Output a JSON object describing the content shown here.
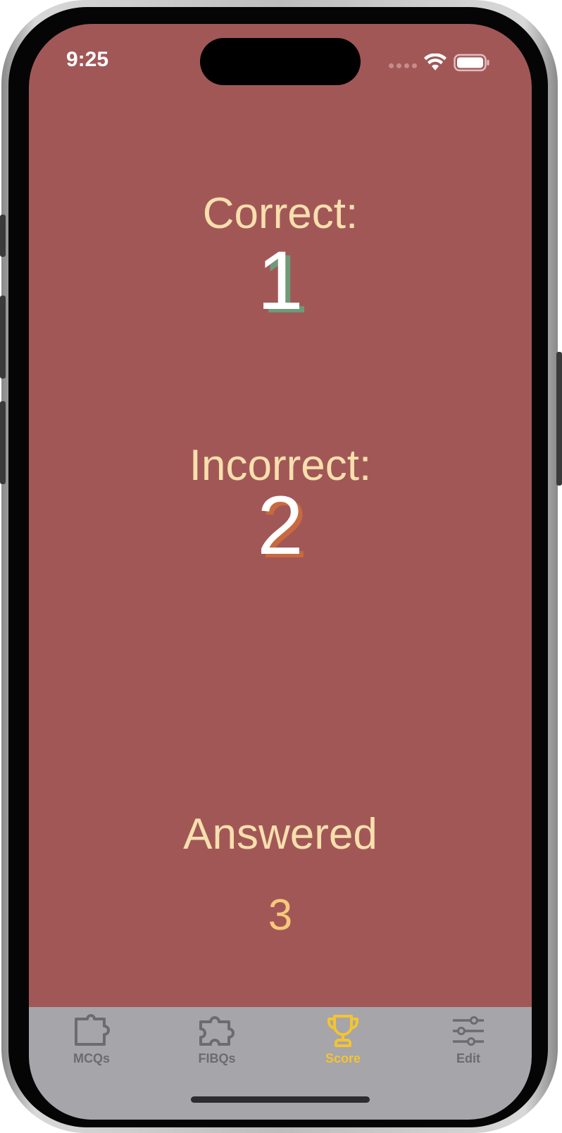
{
  "status_bar": {
    "time": "9:25",
    "wifi_icon": "wifi-icon",
    "battery_icon": "battery-icon"
  },
  "score": {
    "correct_label": "Correct:",
    "correct_value": "1",
    "incorrect_label": "Incorrect:",
    "incorrect_value": "2",
    "answered_label": "Answered",
    "answered_value": "3"
  },
  "tabbar": {
    "active_tab": "Score",
    "tabs": [
      {
        "label": "MCQs",
        "icon": "puzzle-piece-icon"
      },
      {
        "label": "FIBQs",
        "icon": "puzzle-icon"
      },
      {
        "label": "Score",
        "icon": "trophy-icon"
      },
      {
        "label": "Edit",
        "icon": "sliders-icon"
      }
    ]
  },
  "colors": {
    "background": "#a25757",
    "label_text": "#f7dfae",
    "number_text": "#ffffff",
    "correct_shadow": "#6e9a78",
    "incorrect_shadow": "#c8693f",
    "answered_number": "#f7c97a",
    "tabbar_background": "#a5a5aa",
    "tab_inactive": "#6b6b70",
    "tab_active": "#f4c430"
  }
}
